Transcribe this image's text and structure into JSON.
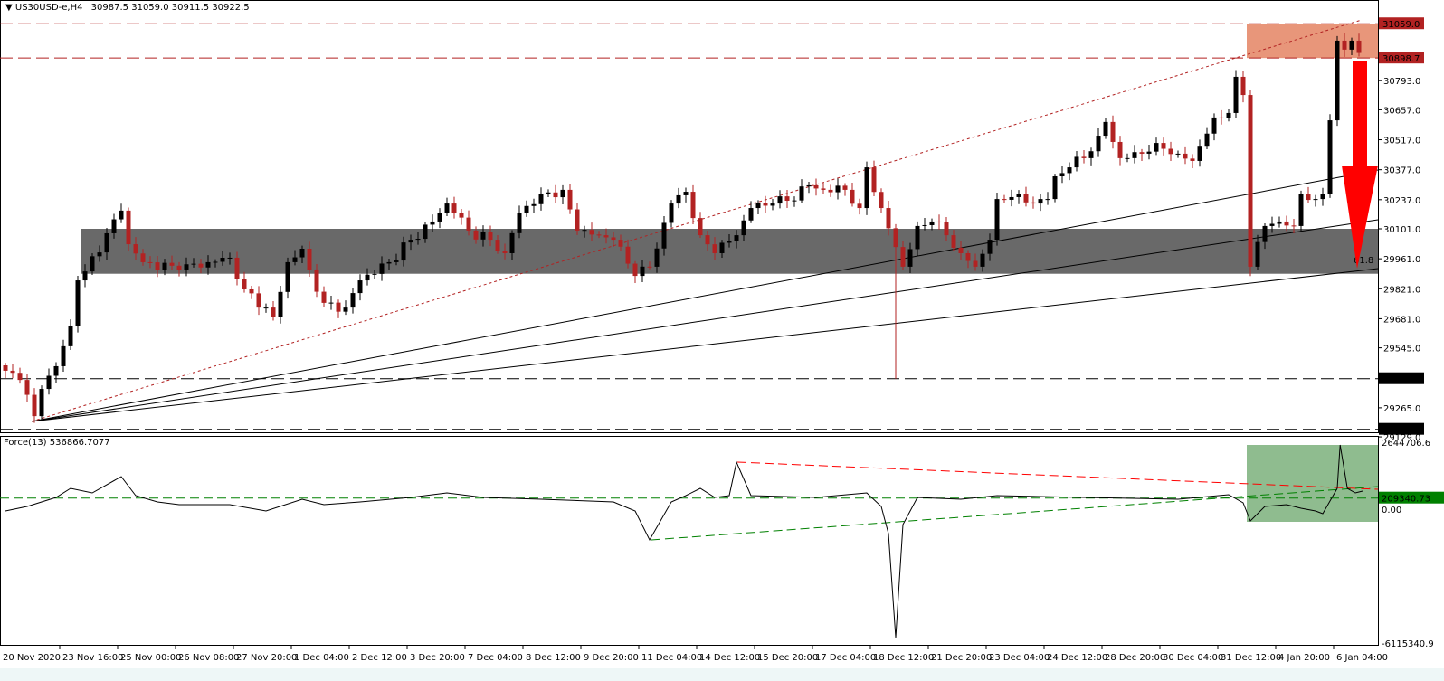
{
  "header": {
    "symbol": "US30USD-e,H4",
    "open": "30987.5",
    "high": "31059.0",
    "low": "30911.5",
    "close": "30922.5",
    "menu_icon": "triangle-down-icon"
  },
  "indicator": {
    "name": "Force(13)",
    "value": "536866.7077"
  },
  "colors": {
    "bull": "#000000",
    "bear": "#b22222",
    "resistance_zone": "#e8967a",
    "support_zone": "#696969",
    "force_zone": "#8fbc8f",
    "arrow": "#ff0000"
  },
  "chart_data": [
    {
      "type": "candlestick",
      "title": "US30USD-e,H4",
      "ylim": [
        29129.0,
        31059.0
      ],
      "price_ticks": [
        "30793.0",
        "30657.0",
        "30517.0",
        "30377.0",
        "30237.0",
        "30101.0",
        "29961.0",
        "29821.0",
        "29681.0",
        "29545.0",
        "29265.0",
        "29129.0"
      ],
      "levels": [
        {
          "label": "31059.0",
          "value": 31059.0,
          "style": "red-dashed"
        },
        {
          "label": "30898.7",
          "value": 30898.7,
          "style": "red-dashed"
        },
        {
          "label": "29400.9",
          "value": 29400.9,
          "style": "black-dashed"
        },
        {
          "label": "29164.4",
          "value": 29164.4,
          "style": "black-dashed"
        }
      ],
      "resistance_zone": [
        30898.7,
        31059.0
      ],
      "support_zone": [
        29891,
        30101
      ],
      "fib_label": "61.8",
      "time_labels": [
        "20 Nov 2020",
        "23 Nov 16:00",
        "25 Nov 00:00",
        "26 Nov 08:00",
        "27 Nov 20:00",
        "1 Dec 04:00",
        "2 Dec 12:00",
        "3 Dec 20:00",
        "7 Dec 04:00",
        "8 Dec 12:00",
        "9 Dec 20:00",
        "11 Dec 04:00",
        "14 Dec 12:00",
        "15 Dec 20:00",
        "17 Dec 04:00",
        "18 Dec 12:00",
        "21 Dec 20:00",
        "23 Dec 04:00",
        "24 Dec 12:00",
        "28 Dec 20:00",
        "30 Dec 04:00",
        "31 Dec 12:00",
        "4 Jan 20:00",
        "6 Jan 04:00"
      ],
      "bars": 188,
      "close_keypoints": [
        [
          0,
          29438
        ],
        [
          2,
          29395
        ],
        [
          4,
          29226
        ],
        [
          5,
          29353
        ],
        [
          7,
          29459
        ],
        [
          9,
          29649
        ],
        [
          10,
          29860
        ],
        [
          11,
          29902
        ],
        [
          14,
          30080
        ],
        [
          16,
          30186
        ],
        [
          17,
          30029
        ],
        [
          19,
          29945
        ],
        [
          24,
          29911
        ],
        [
          28,
          29945
        ],
        [
          31,
          29966
        ],
        [
          33,
          29818
        ],
        [
          36,
          29733
        ],
        [
          37,
          29691
        ],
        [
          39,
          29945
        ],
        [
          41,
          30008
        ],
        [
          42,
          29911
        ],
        [
          44,
          29755
        ],
        [
          47,
          29733
        ],
        [
          49,
          29860
        ],
        [
          53,
          29945
        ],
        [
          56,
          30050
        ],
        [
          59,
          30135
        ],
        [
          61,
          30219
        ],
        [
          62,
          30177
        ],
        [
          64,
          30093
        ],
        [
          67,
          30050
        ],
        [
          69,
          29987
        ],
        [
          71,
          30177
        ],
        [
          74,
          30262
        ],
        [
          77,
          30283
        ],
        [
          79,
          30093
        ],
        [
          82,
          30071
        ],
        [
          84,
          30050
        ],
        [
          87,
          29881
        ],
        [
          89,
          29924
        ],
        [
          92,
          30219
        ],
        [
          94,
          30274
        ],
        [
          96,
          30071
        ],
        [
          98,
          29987
        ],
        [
          101,
          30071
        ],
        [
          103,
          30198
        ],
        [
          106,
          30219
        ],
        [
          108,
          30232
        ],
        [
          111,
          30304
        ],
        [
          113,
          30283
        ],
        [
          116,
          30283
        ],
        [
          118,
          30198
        ],
        [
          119,
          30388
        ],
        [
          121,
          30198
        ],
        [
          124,
          29924
        ],
        [
          126,
          30114
        ],
        [
          128,
          30135
        ],
        [
          130,
          30071
        ],
        [
          132,
          29987
        ],
        [
          134,
          29924
        ],
        [
          136,
          30050
        ],
        [
          137,
          30240
        ],
        [
          139,
          30249
        ],
        [
          142,
          30219
        ],
        [
          144,
          30240
        ],
        [
          145,
          30346
        ],
        [
          147,
          30388
        ],
        [
          149,
          30431
        ],
        [
          151,
          30536
        ],
        [
          152,
          30600
        ],
        [
          154,
          30431
        ],
        [
          157,
          30452
        ],
        [
          159,
          30502
        ],
        [
          162,
          30452
        ],
        [
          164,
          30418
        ],
        [
          167,
          30621
        ],
        [
          169,
          30642
        ],
        [
          170,
          30811
        ],
        [
          171,
          30726
        ],
        [
          172,
          29924
        ],
        [
          174,
          30114
        ],
        [
          176,
          30135
        ],
        [
          178,
          30114
        ],
        [
          179,
          30262
        ],
        [
          181,
          30240
        ],
        [
          182,
          30262
        ],
        [
          184,
          30980
        ],
        [
          185,
          30938
        ],
        [
          186,
          30980
        ],
        [
          187,
          30922.5
        ]
      ],
      "low_overrides": [
        [
          123,
          29400
        ],
        [
          172,
          29880
        ]
      ]
    },
    {
      "type": "line",
      "title": "Force(13)",
      "ylim": [
        -6115340.9,
        2644706.6
      ],
      "tick_labels": [
        "2644706.6",
        "0.00",
        "-6115340.9"
      ],
      "level": {
        "label": "209340.73",
        "value": 209340.73
      },
      "force_keypoints": [
        [
          0,
          -355000
        ],
        [
          3,
          -158000
        ],
        [
          7,
          237000
        ],
        [
          9,
          631000
        ],
        [
          12,
          434000
        ],
        [
          16,
          1144000
        ],
        [
          18,
          316000
        ],
        [
          21,
          39000
        ],
        [
          24,
          -79000
        ],
        [
          31,
          -79000
        ],
        [
          36,
          -355000
        ],
        [
          41,
          158000
        ],
        [
          44,
          -79000
        ],
        [
          49,
          39000
        ],
        [
          56,
          237000
        ],
        [
          61,
          434000
        ],
        [
          66,
          237000
        ],
        [
          74,
          158000
        ],
        [
          84,
          39000
        ],
        [
          87,
          -355000
        ],
        [
          89,
          -1618000
        ],
        [
          92,
          39000
        ],
        [
          94,
          316000
        ],
        [
          96,
          631000
        ],
        [
          98,
          237000
        ],
        [
          100,
          316000
        ],
        [
          101,
          1776000
        ],
        [
          103,
          316000
        ],
        [
          112,
          237000
        ],
        [
          119,
          434000
        ],
        [
          121,
          -158000
        ],
        [
          122,
          -1342000
        ],
        [
          123,
          -5880000
        ],
        [
          124,
          -947000
        ],
        [
          126,
          237000
        ],
        [
          132,
          158000
        ],
        [
          137,
          316000
        ],
        [
          149,
          237000
        ],
        [
          162,
          158000
        ],
        [
          169,
          355000
        ],
        [
          171,
          0
        ],
        [
          172,
          -789000
        ],
        [
          174,
          -158000
        ],
        [
          177,
          -79000
        ],
        [
          179,
          -237000
        ],
        [
          181,
          -355000
        ],
        [
          182,
          -474000
        ],
        [
          184,
          631000
        ],
        [
          184.4,
          2525000
        ],
        [
          185.4,
          631000
        ],
        [
          186.5,
          434000
        ],
        [
          187.5,
          513000
        ]
      ]
    }
  ]
}
